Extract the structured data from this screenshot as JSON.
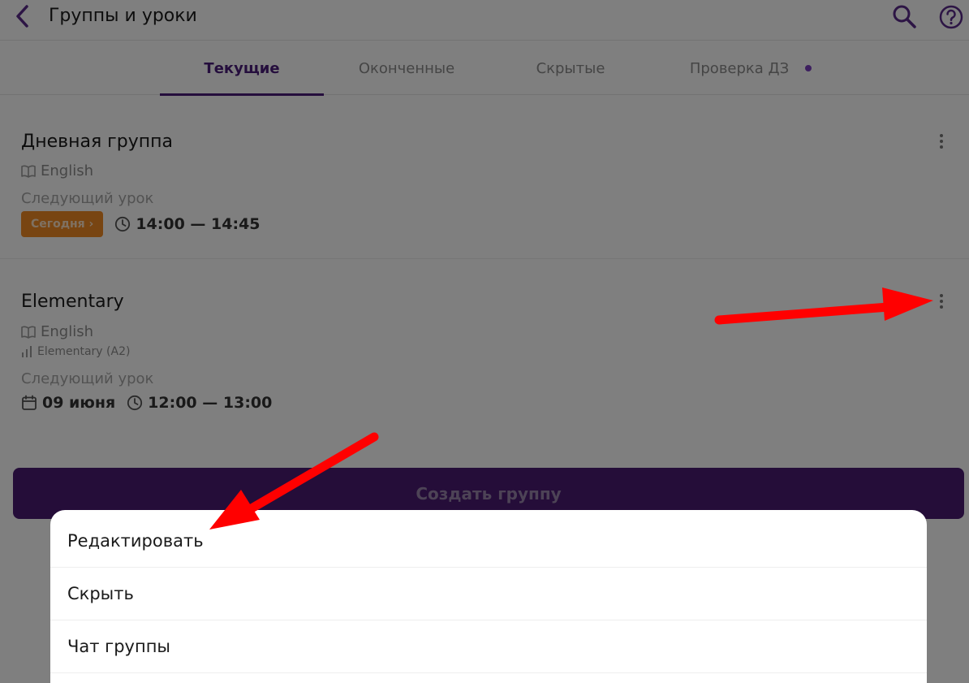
{
  "header": {
    "title": "Группы и уроки"
  },
  "tabs": [
    {
      "label": "Текущие",
      "active": true
    },
    {
      "label": "Оконченные",
      "active": false
    },
    {
      "label": "Скрытые",
      "active": false
    },
    {
      "label": "Проверка ДЗ",
      "active": false,
      "has_dot": true
    }
  ],
  "groups": [
    {
      "name": "Дневная группа",
      "subject": "English",
      "next_label": "Следующий урок",
      "badge": "Сегодня ›",
      "time": "14:00 — 14:45"
    },
    {
      "name": "Elementary",
      "subject": "English",
      "level": "Elementary (A2)",
      "next_label": "Следующий урок",
      "date": "09 июня",
      "time": "12:00 — 13:00"
    }
  ],
  "create_button": "Создать группу",
  "menu": {
    "items": [
      "Редактировать",
      "Скрыть",
      "Чат группы"
    ]
  },
  "colors": {
    "accent": "#4a1d7a",
    "badge": "#f08a24",
    "annotation_arrow": "#ff0000"
  },
  "icons": [
    "back-arrow-icon",
    "search-icon",
    "help-icon",
    "book-icon",
    "level-bars-icon",
    "clock-icon",
    "calendar-icon",
    "more-vertical-icon"
  ]
}
